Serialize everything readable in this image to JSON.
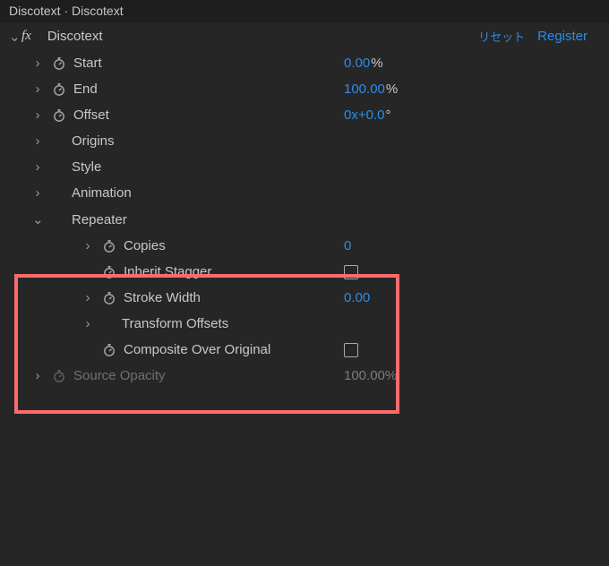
{
  "title_bar": "Discotext · Discotext",
  "header": {
    "effect_name": "Discotext",
    "reset_label": "リセット",
    "register_label": "Register"
  },
  "props": {
    "start": {
      "label": "Start",
      "value": "0.00",
      "unit": "%"
    },
    "end": {
      "label": "End",
      "value": "100.00",
      "unit": "%"
    },
    "offset": {
      "label": "Offset",
      "value": "0x+0.0",
      "unit": "°"
    },
    "origins": {
      "label": "Origins"
    },
    "style": {
      "label": "Style"
    },
    "animation": {
      "label": "Animation"
    },
    "repeater": {
      "label": "Repeater",
      "copies": {
        "label": "Copies",
        "value": "0"
      },
      "inherit": {
        "label": "Inherit Stagger",
        "checked": false
      },
      "stroke_width": {
        "label": "Stroke Width",
        "value": "0.00"
      },
      "transform": {
        "label": "Transform Offsets"
      },
      "composite": {
        "label": "Composite Over Original",
        "checked": false
      }
    },
    "source_opacity": {
      "label": "Source Opacity",
      "value": "100.00",
      "unit": "%"
    }
  }
}
